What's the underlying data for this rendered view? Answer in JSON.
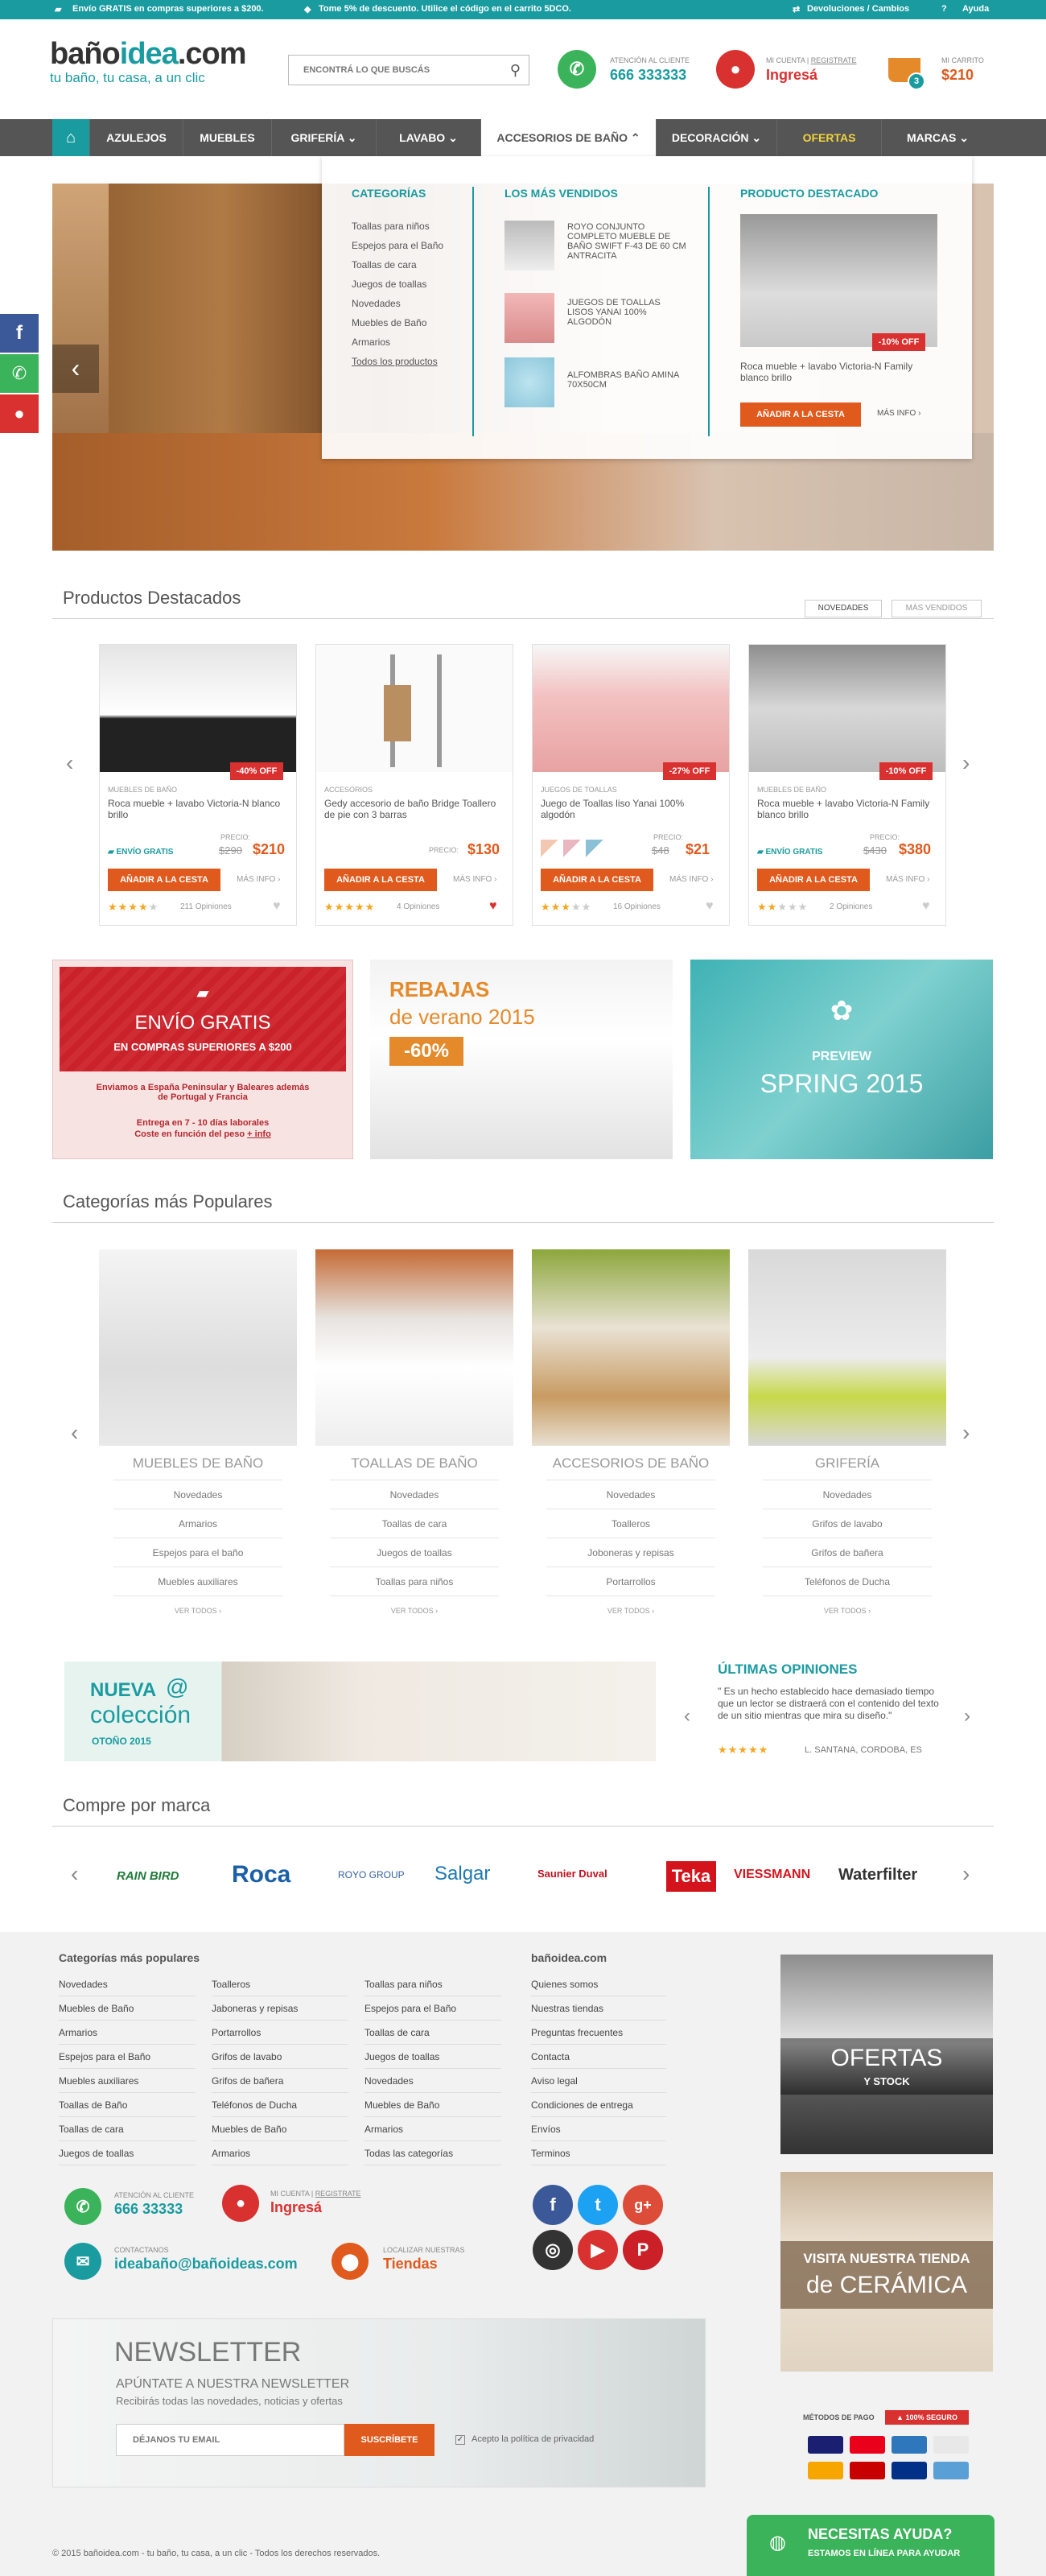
{
  "topbar": {
    "free_shipping": "Envío GRATIS en compras superiores a $200.",
    "discount": "Tome 5% de descuento. Utilice el código en el carrito 5DCO.",
    "returns": "Devoluciones / Cambios",
    "help": "Ayuda"
  },
  "header": {
    "logo_a": "baño",
    "logo_b": "idea",
    "logo_c": ".com",
    "tagline": "tu baño, tu casa, a un clic",
    "search_placeholder": "ENCONTRÁ LO QUE BUSCÁS",
    "support_label": "ATENCIÓN AL CLIENTE",
    "support_phone": "666 333333",
    "account_label": "MI CUENTA",
    "register": "REGISTRATE",
    "login": "Ingresá",
    "cart_label": "MI CARRITO",
    "cart_total": "$210",
    "cart_count": "3"
  },
  "nav": {
    "items": [
      "AZULEJOS",
      "MUEBLES",
      "GRIFERÍA",
      "LAVABO",
      "ACCESORIOS DE BAÑO",
      "DECORACIÓN",
      "OFERTAS",
      "MARCAS"
    ]
  },
  "dropdown": {
    "cat_title": "CATEGORÍAS",
    "cats": [
      "Toallas para niños",
      "Espejos para el Baño",
      "Toallas de cara",
      "Juegos de toallas",
      "Novedades",
      "Muebles de Baño",
      "Armarios",
      "Todos los productos"
    ],
    "best_title": "LOS MÁS VENDIDOS",
    "best": [
      "ROYO CONJUNTO COMPLETO MUEBLE DE BAÑO SWIFT F-43 DE 60 CM ANTRACITA",
      "JUEGOS DE TOALLAS LISOS YANAI 100% ALGODÓN",
      "ALFOMBRAS BAÑO AMINA 70X50CM"
    ],
    "feat_title": "PRODUCTO DESTACADO",
    "feat_name": "Roca mueble + lavabo Victoria-N Family blanco brillo",
    "feat_off": "-10% OFF",
    "feat_btn": "AÑADIR A LA CESTA",
    "feat_more": "MÁS INFO"
  },
  "featured": {
    "title": "Productos Destacados",
    "tab_new": "NOVEDADES",
    "tab_best": "MÁS VENDIDOS",
    "cards": [
      {
        "off": "-40% OFF",
        "cat": "MUEBLES DE BAÑO",
        "name": "Roca mueble + lavabo Victoria-N blanco brillo",
        "ship": "ENVÍO GRATIS",
        "old": "$290",
        "price": "$210",
        "price_lbl": "PRECIO:",
        "btn": "AÑADIR A LA CESTA",
        "more": "MÁS INFO",
        "stars": 4,
        "reviews": "211 Opiniones"
      },
      {
        "off": "",
        "cat": "ACCESORIOS",
        "name": "Gedy accesorio de baño Bridge Toallero de pie con 3 barras",
        "ship": "",
        "old": "",
        "price": "$130",
        "price_lbl": "PRECIO:",
        "btn": "AÑADIR A LA CESTA",
        "more": "MÁS INFO",
        "stars": 5,
        "reviews": "4 Opiniones"
      },
      {
        "off": "-27% OFF",
        "cat": "JUEGOS DE TOALLAS",
        "name": "Juego de Toallas liso Yanai 100% algodón",
        "ship": "",
        "old": "$48",
        "price": "$21",
        "price_lbl": "PRECIO:",
        "btn": "AÑADIR A LA CESTA",
        "more": "MÁS INFO",
        "stars": 3,
        "reviews": "16 Opiniones"
      },
      {
        "off": "-10% OFF",
        "cat": "MUEBLES DE BAÑO",
        "name": "Roca mueble + lavabo Victoria-N Family blanco brillo",
        "ship": "ENVÍO GRATIS",
        "old": "$430",
        "price": "$380",
        "price_lbl": "PRECIO:",
        "btn": "AÑADIR A LA CESTA",
        "more": "MÁS INFO",
        "stars": 2,
        "reviews": "2 Opiniones"
      }
    ]
  },
  "promos": {
    "ship_title": "ENVÍO GRATIS",
    "ship_sub": "EN COMPRAS SUPERIORES A $200",
    "ship_t1": "Enviamos a España Peninsular y Baleares además de Portugal y Francia",
    "ship_t2": "Entrega en 7 - 10 días laborales",
    "ship_t3": "Coste en función del peso",
    "ship_more": "+ info",
    "sale_t1": "REBAJAS",
    "sale_t2": "de verano 2015",
    "sale_pct": "-60%",
    "spring_t1": "PREVIEW",
    "spring_t2": "SPRING 2015"
  },
  "popular": {
    "title": "Categorías más Populares",
    "see_all": "VER TODOS",
    "cats": [
      {
        "name": "MUEBLES DE BAÑO",
        "links": [
          "Novedades",
          "Armarios",
          "Espejos para el baño",
          "Muebles auxiliares"
        ]
      },
      {
        "name": "TOALLAS DE BAÑO",
        "links": [
          "Novedades",
          "Toallas de cara",
          "Juegos de toallas",
          "Toallas para niños"
        ]
      },
      {
        "name": "ACCESORIOS DE BAÑO",
        "links": [
          "Novedades",
          "Toalleros",
          "Joboneras y repisas",
          "Portarrollos"
        ]
      },
      {
        "name": "GRIFERÍA",
        "links": [
          "Novedades",
          "Grifos de lavabo",
          "Grifos de bañera",
          "Teléfonos de Ducha"
        ]
      }
    ]
  },
  "collection": {
    "t1": "NUEVA",
    "t2": "colección",
    "t3": "OTOÑO 2015"
  },
  "opinions": {
    "title": "ÚLTIMAS OPINIONES",
    "text": "\" Es un hecho establecido hace demasiado tiempo que un lector se distraerá con el contenido del texto de un sitio mientras que mira su diseño.\"",
    "author": "L. SANTANA, CORDOBA, ES"
  },
  "brands": {
    "title": "Compre por marca",
    "list": [
      "RAIN BIRD",
      "Roca",
      "ROYO GROUP",
      "Salgar",
      "Saunier Duval",
      "Teka",
      "VIESSMANN",
      "Waterfilter"
    ]
  },
  "footer": {
    "cat_title": "Categorías más populares",
    "col1": [
      "Novedades",
      "Muebles de Baño",
      "Armarios",
      "Espejos para el Baño",
      "Muebles auxiliares",
      "Toallas de Baño",
      "Toallas de cara",
      "Juegos de toallas"
    ],
    "col2": [
      "Toalleros",
      "Jaboneras y repisas",
      "Portarrollos",
      "Grifos de lavabo",
      "Grifos de bañera",
      "Teléfonos de Ducha",
      "Muebles de Baño",
      "Armarios"
    ],
    "col3": [
      "Toallas para niños",
      "Espejos para el Baño",
      "Toallas de cara",
      "Juegos de toallas",
      "Novedades",
      "Muebles de Baño",
      "Armarios",
      "Todas las categorías"
    ],
    "site_title": "bañoidea.com",
    "site": [
      "Quienes somos",
      "Nuestras tiendas",
      "Preguntas frecuentes",
      "Contacta",
      "Aviso legal",
      "Condiciones de entrega",
      "Envíos",
      "Terminos"
    ],
    "support_label": "ATENCIÓN AL CLIENTE",
    "support_phone": "666 33333",
    "account_label": "MI CUENTA",
    "register": "REGISTRATE",
    "login": "Ingresá",
    "contact_label": "CONTACTANOS",
    "email": "ideabaño@bañoideas.com",
    "stores_label": "LOCALIZAR NUESTRAS",
    "stores": "Tiendas",
    "offers_t1": "OFERTAS",
    "offers_t2": "Y STOCK",
    "visit_t1": "VISITA NUESTRA TIENDA",
    "visit_t2": "de CERÁMICA",
    "nl_title": "NEWSLETTER",
    "nl_sub": "APÚNTATE A NUESTRA NEWSLETTER",
    "nl_sub2": "Recibirás todas las novedades, noticias y ofertas",
    "nl_placeholder": "DÉJANOS TU EMAIL",
    "nl_btn": "SUSCRÍBETE",
    "nl_privacy": "Acepto la política de privacidad",
    "pay_label": "MÉTODOS DE PAGO",
    "secure": "100% SEGURO",
    "copyright": "© 2015 bañoidea.com - tu baño, tu casa, a un clic - Todos los derechos reservados.",
    "help_t1": "NECESITAS AYUDA?",
    "help_t2": "ESTAMOS EN LÍNEA PARA AYUDAR"
  },
  "colors": {
    "teal": "#1a9ba0",
    "orange": "#e05a1d",
    "red": "#d93030",
    "nav": "#555555"
  }
}
